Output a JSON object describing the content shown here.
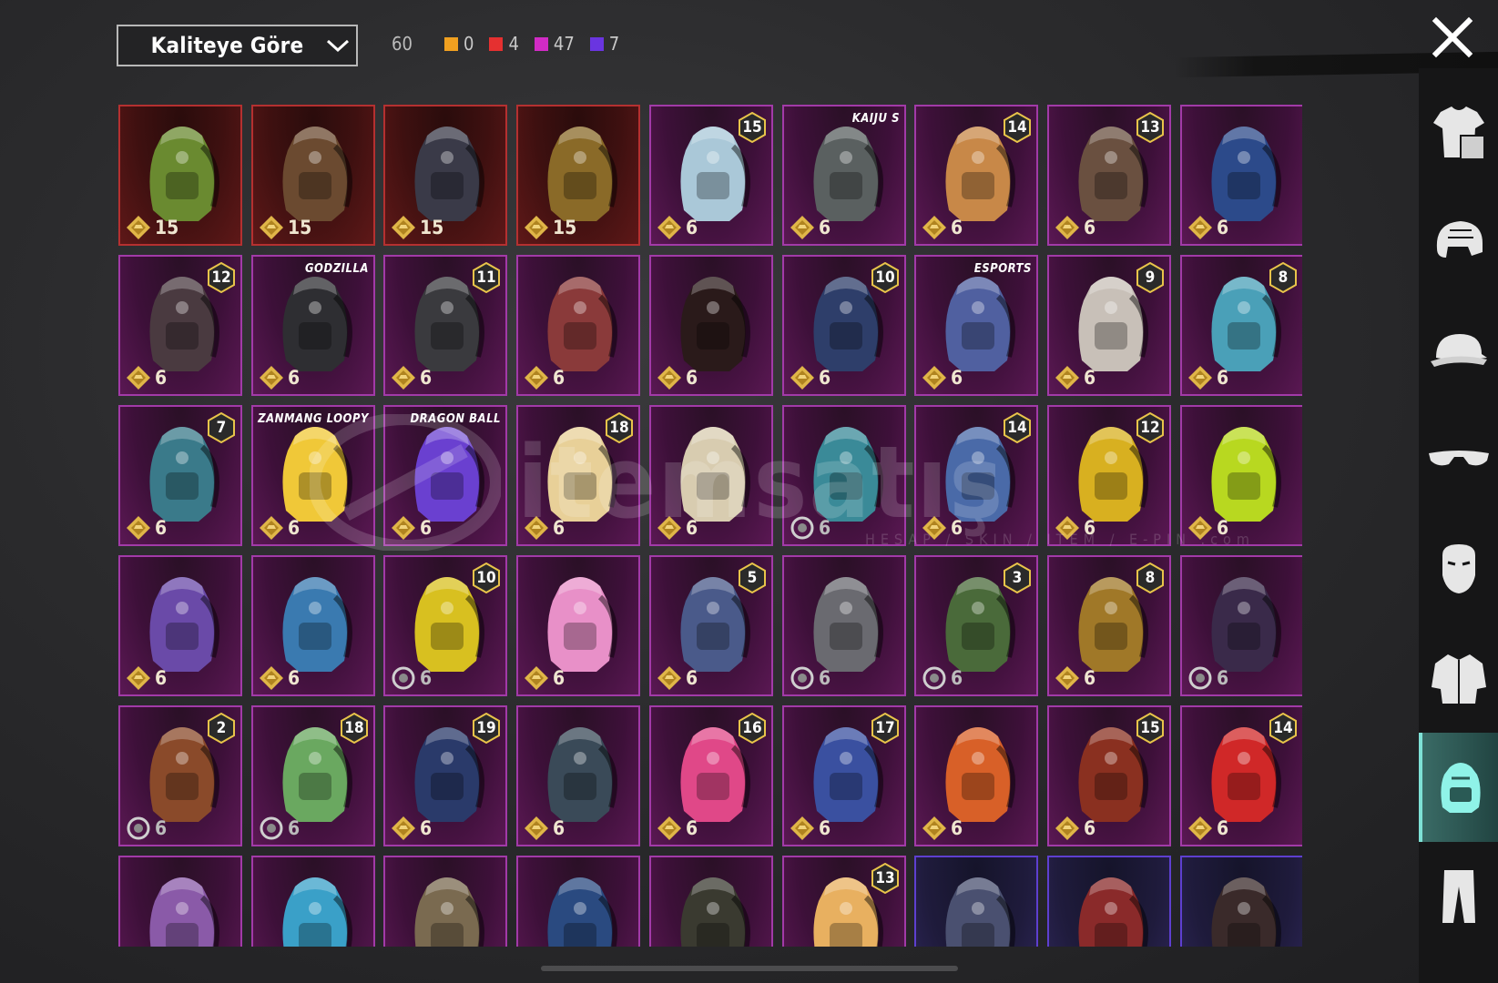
{
  "header": {
    "sort_label": "Kaliteye Göre",
    "total": "60",
    "counters": [
      {
        "color": "#f0a020",
        "value": "0"
      },
      {
        "color": "#e53030",
        "value": "4"
      },
      {
        "color": "#d12bc5",
        "value": "47"
      },
      {
        "color": "#6a35e0",
        "value": "7"
      }
    ],
    "close_icon": "close-icon"
  },
  "items": [
    {
      "price": "15",
      "rarity": "red",
      "hue": "#6a8a30"
    },
    {
      "price": "15",
      "rarity": "red",
      "hue": "#6b4a30"
    },
    {
      "price": "15",
      "rarity": "red",
      "hue": "#3a3a48"
    },
    {
      "price": "15",
      "rarity": "red",
      "hue": "#8a6a28"
    },
    {
      "price": "6",
      "rarity": "purple",
      "level": "15",
      "hue": "#aac8d8"
    },
    {
      "price": "6",
      "rarity": "purple",
      "brand": "KAIJU S",
      "hue": "#5a6060"
    },
    {
      "price": "6",
      "rarity": "purple",
      "level": "14",
      "hue": "#c88848"
    },
    {
      "price": "6",
      "rarity": "purple",
      "level": "13",
      "hue": "#6a5040"
    },
    {
      "price": "6",
      "rarity": "purple",
      "hue": "#2c4a8a"
    },
    {
      "price": "6",
      "rarity": "purple",
      "level": "12",
      "hue": "#4a3a40"
    },
    {
      "price": "6",
      "rarity": "purple",
      "brand": "GODZILLA",
      "hue": "#2e2e32"
    },
    {
      "price": "6",
      "rarity": "purple",
      "level": "11",
      "hue": "#3a3a3e"
    },
    {
      "price": "6",
      "rarity": "purple",
      "hue": "#8a3a3a"
    },
    {
      "price": "6",
      "rarity": "purple",
      "hue": "#2a1a1a"
    },
    {
      "price": "6",
      "rarity": "purple",
      "level": "10",
      "hue": "#2e3e6a"
    },
    {
      "price": "6",
      "rarity": "purple",
      "brand": "ESPORTS",
      "hue": "#5060a0"
    },
    {
      "price": "6",
      "rarity": "purple",
      "level": "9",
      "hue": "#c8c0b8"
    },
    {
      "price": "6",
      "rarity": "purple",
      "level": "8",
      "hue": "#4aa0b8"
    },
    {
      "price": "6",
      "rarity": "purple",
      "level": "7",
      "hue": "#3a7a8a"
    },
    {
      "price": "6",
      "rarity": "purple",
      "brand": "ZANMANG LOOPY",
      "hue": "#f0c838"
    },
    {
      "price": "6",
      "rarity": "purple",
      "brand": "DRAGON BALL",
      "hue": "#6a40d0"
    },
    {
      "price": "6",
      "rarity": "purple",
      "level": "18",
      "hue": "#e8d098"
    },
    {
      "price": "6",
      "rarity": "purple",
      "hue": "#d8ccb0"
    },
    {
      "price": "6",
      "rarity": "purple",
      "dim": true,
      "hue": "#3a8a98"
    },
    {
      "price": "6",
      "rarity": "purple",
      "level": "14",
      "hue": "#4a6aa8"
    },
    {
      "price": "6",
      "rarity": "purple",
      "level": "12",
      "hue": "#d8b020"
    },
    {
      "price": "6",
      "rarity": "purple",
      "hue": "#b8d820"
    },
    {
      "price": "6",
      "rarity": "purple",
      "hue": "#6a4aa8"
    },
    {
      "price": "6",
      "rarity": "purple",
      "hue": "#3a7ab0"
    },
    {
      "price": "6",
      "rarity": "purple",
      "level": "10",
      "dim": true,
      "hue": "#d8c020"
    },
    {
      "price": "6",
      "rarity": "purple",
      "hue": "#e890c8"
    },
    {
      "price": "6",
      "rarity": "purple",
      "level": "5",
      "hue": "#4a5a8a"
    },
    {
      "price": "6",
      "rarity": "purple",
      "dim": true,
      "hue": "#6a6a70"
    },
    {
      "price": "6",
      "rarity": "purple",
      "level": "3",
      "dim": true,
      "hue": "#4a6a3a"
    },
    {
      "price": "6",
      "rarity": "purple",
      "level": "8",
      "hue": "#a07828"
    },
    {
      "price": "6",
      "rarity": "purple",
      "dim": true,
      "hue": "#3a2a4a"
    },
    {
      "price": "6",
      "rarity": "purple",
      "level": "2",
      "dim": true,
      "hue": "#8a4a2a"
    },
    {
      "price": "6",
      "rarity": "purple",
      "level": "18",
      "dim": true,
      "hue": "#6aa860"
    },
    {
      "price": "6",
      "rarity": "purple",
      "level": "19",
      "hue": "#2a3a6a"
    },
    {
      "price": "6",
      "rarity": "purple",
      "hue": "#3a4a58"
    },
    {
      "price": "6",
      "rarity": "purple",
      "level": "16",
      "hue": "#e04888"
    },
    {
      "price": "6",
      "rarity": "purple",
      "level": "17",
      "hue": "#3a50a0"
    },
    {
      "price": "6",
      "rarity": "purple",
      "hue": "#d86028"
    },
    {
      "price": "6",
      "rarity": "purple",
      "level": "15",
      "hue": "#8a3020"
    },
    {
      "price": "6",
      "rarity": "purple",
      "level": "14",
      "hue": "#d02828"
    },
    {
      "rarity": "purple",
      "hue": "#8a5aa8"
    },
    {
      "rarity": "purple",
      "hue": "#3aa0c8"
    },
    {
      "rarity": "purple",
      "hue": "#7a6a50"
    },
    {
      "rarity": "purple",
      "hue": "#2a4a80"
    },
    {
      "rarity": "purple",
      "hue": "#3a3a30"
    },
    {
      "rarity": "purple",
      "level": "13",
      "hue": "#e8b060"
    },
    {
      "rarity": "blue",
      "hue": "#4a5070"
    },
    {
      "rarity": "blue",
      "hue": "#8a2a2a"
    },
    {
      "rarity": "blue",
      "hue": "#3a2a2a"
    }
  ],
  "watermark": {
    "text": "itemsatış",
    "sub": "HESAP / SKIN / ITEM / E-PIN .com"
  },
  "sidebar": [
    {
      "name": "outfit-tab",
      "icon": "shirt-icon"
    },
    {
      "name": "helmet-tab",
      "icon": "helmet-icon"
    },
    {
      "name": "hat-tab",
      "icon": "cap-icon"
    },
    {
      "name": "glasses-tab",
      "icon": "glasses-icon"
    },
    {
      "name": "mask-tab",
      "icon": "mask-icon"
    },
    {
      "name": "jacket-tab",
      "icon": "jacket-icon"
    },
    {
      "name": "backpack-tab",
      "icon": "backpack-icon",
      "active": true
    },
    {
      "name": "pants-tab",
      "icon": "pants-icon"
    }
  ]
}
